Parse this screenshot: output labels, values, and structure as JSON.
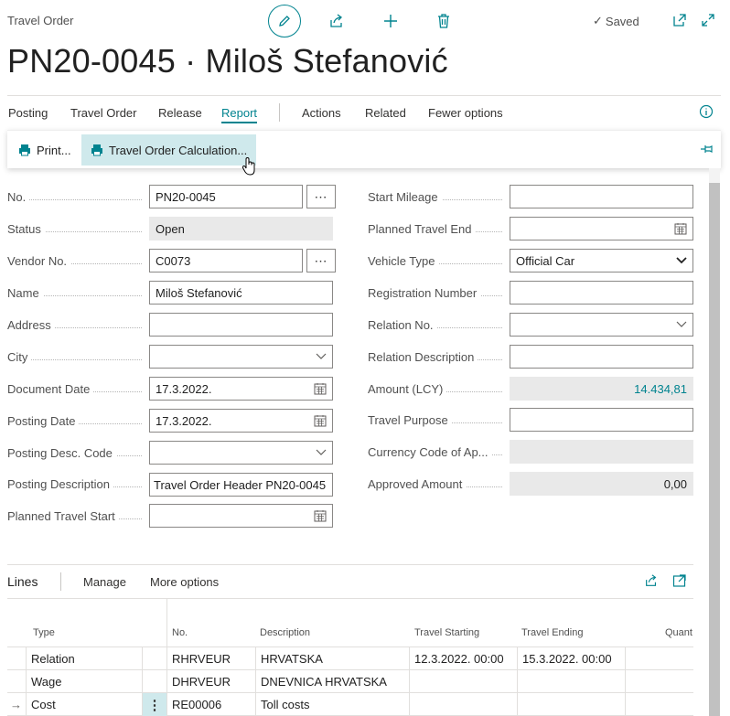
{
  "header": {
    "breadcrumb": "Travel Order",
    "title": "PN20-0045 · Miloš Stefanović",
    "saved_label": "Saved",
    "accent": "#00838f"
  },
  "actionbar": {
    "items": [
      "Posting",
      "Travel Order",
      "Release",
      "Report",
      "Actions",
      "Related",
      "Fewer options"
    ],
    "active": "Report"
  },
  "ribbon": {
    "print_label": "Print...",
    "calc_label": "Travel Order Calculation..."
  },
  "form_left": [
    {
      "label": "No.",
      "value": "PN20-0045"
    },
    {
      "label": "Status",
      "value": "Open"
    },
    {
      "label": "Vendor No.",
      "value": "C0073"
    },
    {
      "label": "Name",
      "value": "Miloš Stefanović"
    },
    {
      "label": "Address",
      "value": ""
    },
    {
      "label": "City",
      "value": ""
    },
    {
      "label": "Document Date",
      "value": "17.3.2022."
    },
    {
      "label": "Posting Date",
      "value": "17.3.2022."
    },
    {
      "label": "Posting Desc. Code",
      "value": ""
    },
    {
      "label": "Posting Description",
      "value": "Travel Order Header PN20-0045"
    },
    {
      "label": "Planned Travel Start",
      "value": ""
    }
  ],
  "form_right": [
    {
      "label": "Start Mileage",
      "value": ""
    },
    {
      "label": "Planned Travel End",
      "value": ""
    },
    {
      "label": "Vehicle Type",
      "value": "Official Car"
    },
    {
      "label": "Registration Number",
      "value": ""
    },
    {
      "label": "Relation No.",
      "value": ""
    },
    {
      "label": "Relation Description",
      "value": ""
    },
    {
      "label": "Amount (LCY)",
      "value": "14.434,81"
    },
    {
      "label": "Travel Purpose",
      "value": ""
    },
    {
      "label": "Currency Code of Ap...",
      "value": ""
    },
    {
      "label": "Approved Amount",
      "value": "0,00"
    }
  ],
  "lines": {
    "title": "Lines",
    "manage": "Manage",
    "more_options": "More options",
    "columns": [
      "Type",
      "No.",
      "Description",
      "Travel Starting",
      "Travel Ending",
      "Quant"
    ],
    "rows": [
      {
        "type": "Relation",
        "no": "RHRVEUR",
        "description": "HRVATSKA",
        "start": "12.3.2022. 00:00",
        "end": "15.3.2022. 00:00"
      },
      {
        "type": "Wage",
        "no": "DHRVEUR",
        "description": "DNEVNICA HRVATSKA",
        "start": "",
        "end": ""
      },
      {
        "type": "Cost",
        "no": "RE00006",
        "description": "Toll costs",
        "start": "",
        "end": ""
      }
    ]
  }
}
